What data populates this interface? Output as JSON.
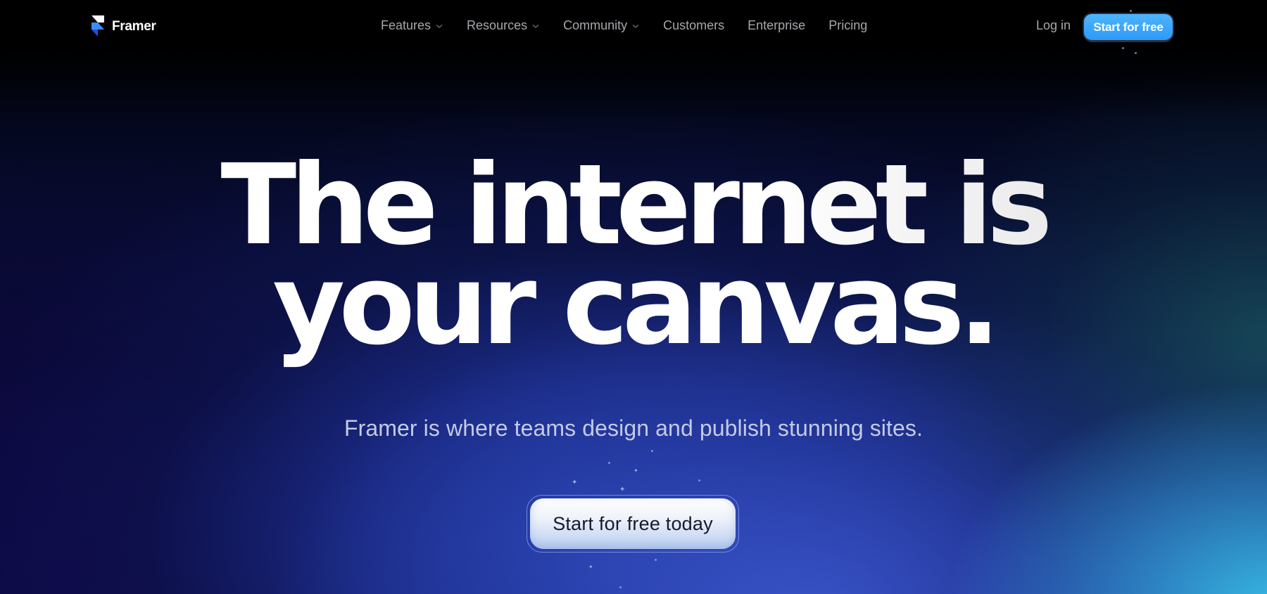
{
  "brand": {
    "name": "Framer",
    "logo_icon": "framer-logo-icon",
    "logo_colors": {
      "top": "#ffffff",
      "middle": "#3b8cff",
      "bottom": "#1f4fe0"
    }
  },
  "nav": {
    "items": [
      {
        "label": "Features",
        "has_dropdown": true,
        "icon": "chevron-down-icon"
      },
      {
        "label": "Resources",
        "has_dropdown": true,
        "icon": "chevron-down-icon"
      },
      {
        "label": "Community",
        "has_dropdown": true,
        "icon": "chevron-down-icon"
      },
      {
        "label": "Customers",
        "has_dropdown": false
      },
      {
        "label": "Enterprise",
        "has_dropdown": false
      },
      {
        "label": "Pricing",
        "has_dropdown": false
      }
    ],
    "login_label": "Log in",
    "start_label": "Start for free",
    "accent_color": "#3aa6ff"
  },
  "hero": {
    "headline_line1": "The internet is",
    "headline_line2": "your canvas.",
    "subheadline": "Framer is where teams design and publish stunning sites.",
    "cta_label": "Start for free today"
  },
  "colors": {
    "background_top": "#000000",
    "background_mid": "#1a2a7a",
    "glow_bottom_right": "#38bde6",
    "nav_text": "#a7a7ad",
    "subheadline_text": "#c4cae6",
    "cta_text": "#151b2b"
  }
}
